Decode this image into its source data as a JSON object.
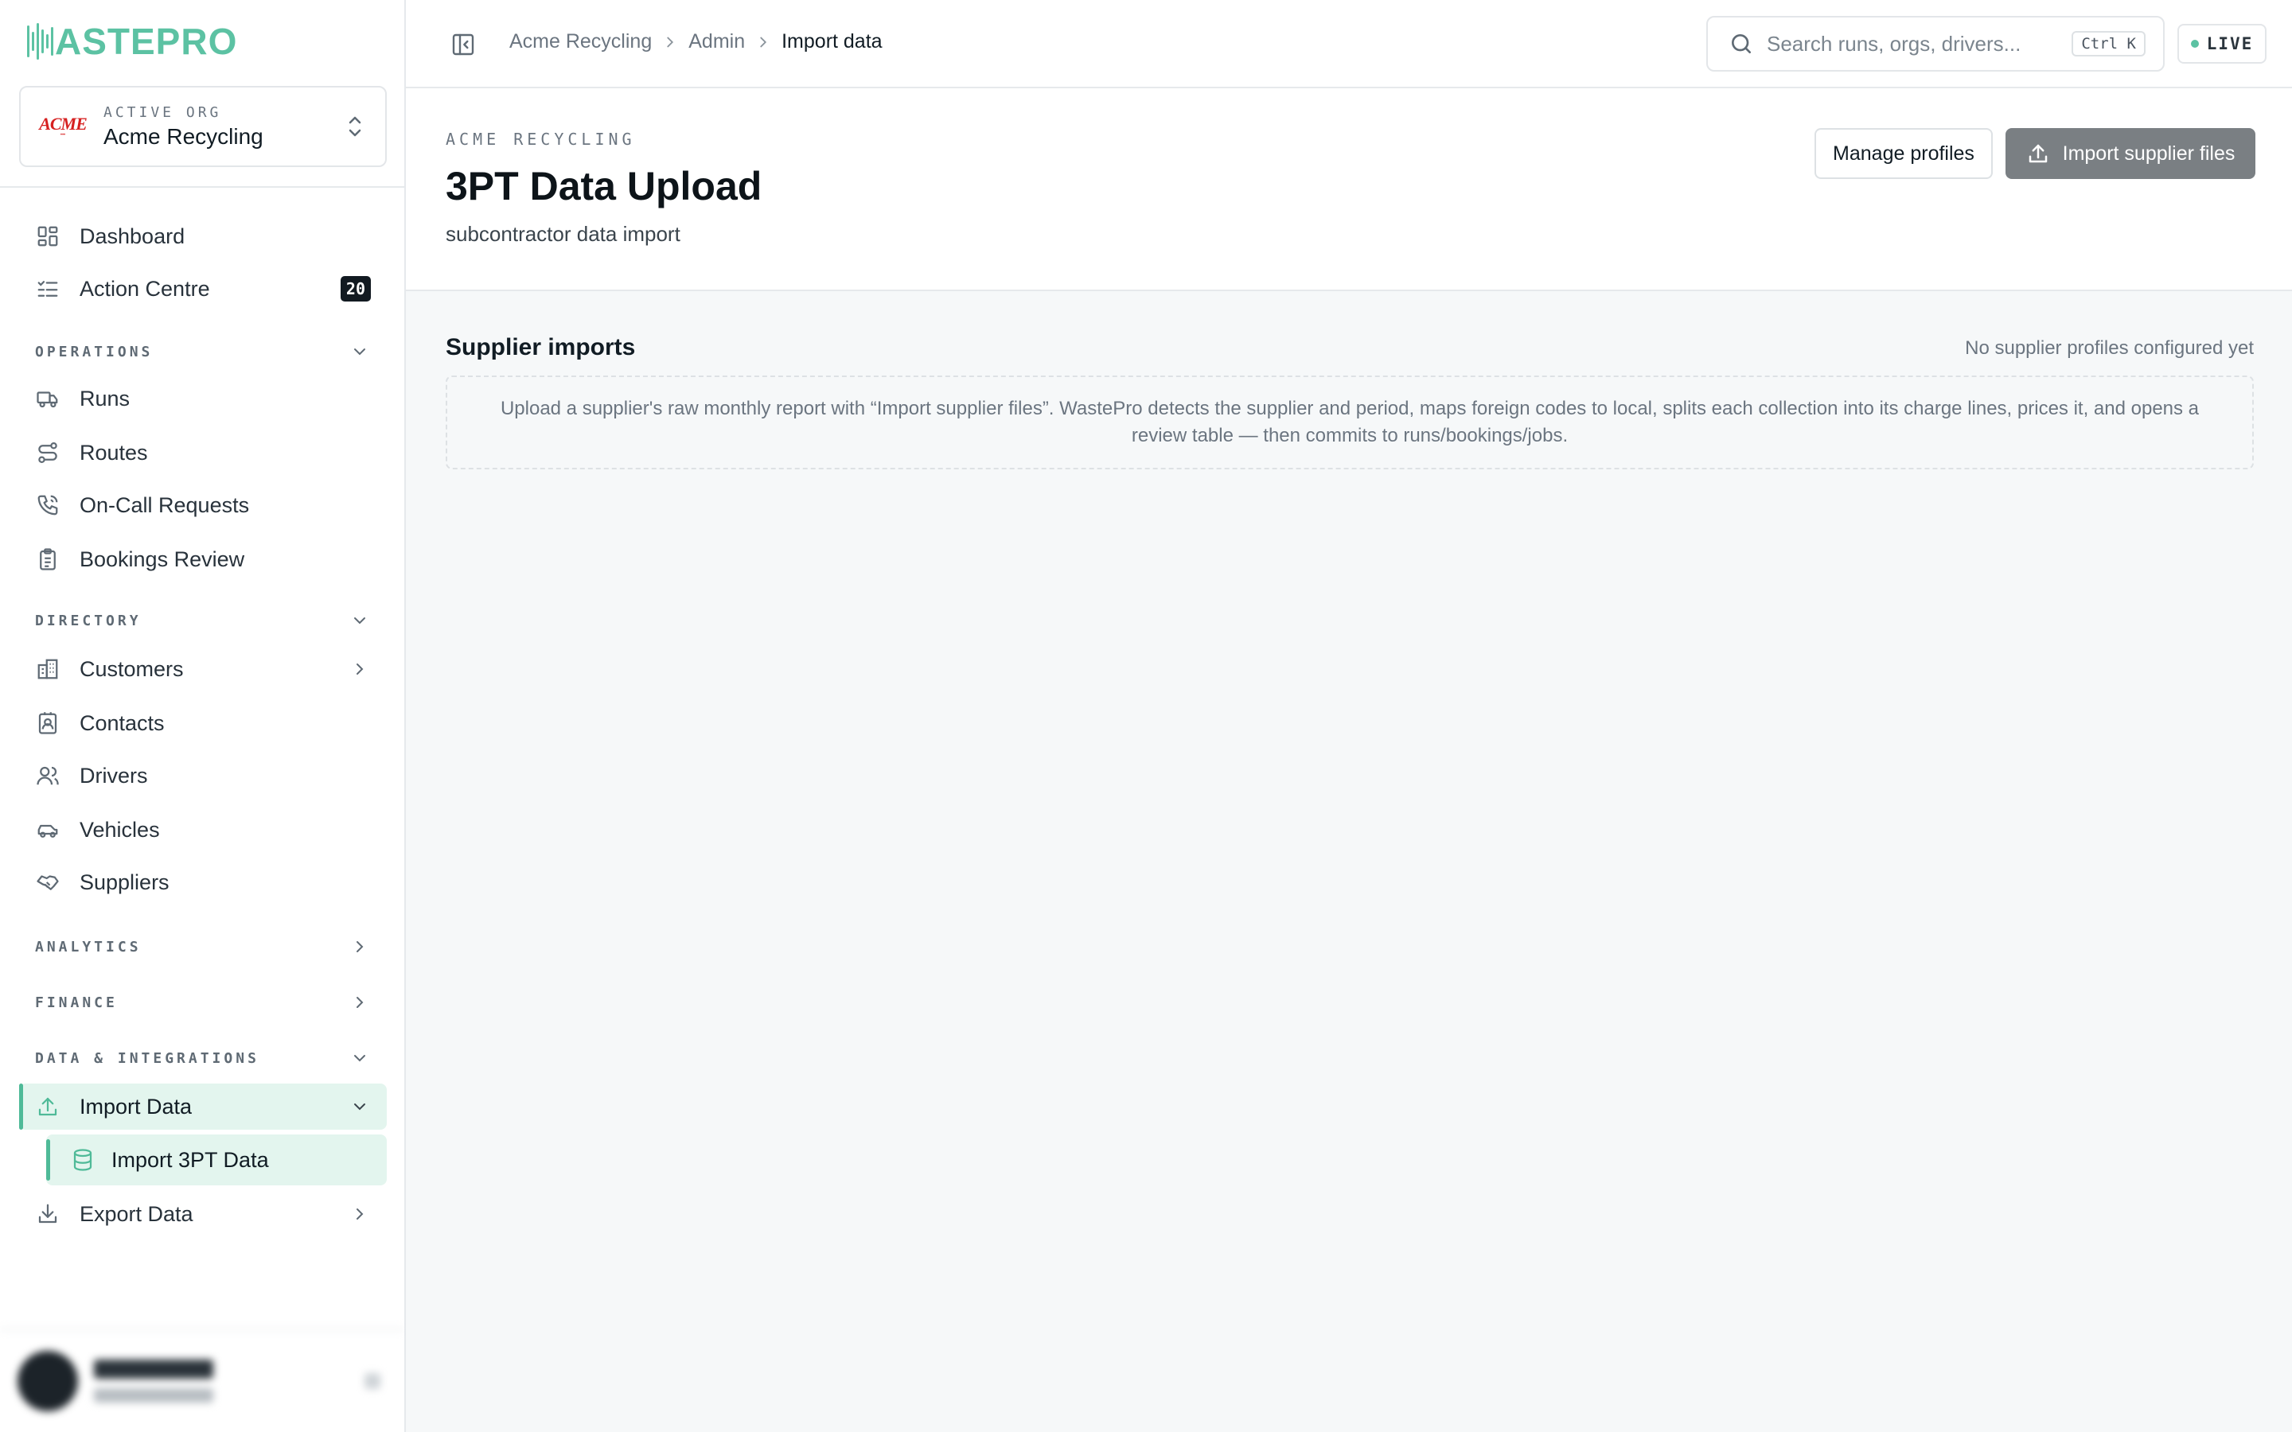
{
  "brand": {
    "logo_text": "ASTEPRO",
    "accent": "#5cc2a3"
  },
  "org": {
    "label": "ACTIVE ORG",
    "name": "Acme Recycling",
    "logo_text": "ACME"
  },
  "sidebar": {
    "top_items": [
      {
        "label": "Dashboard",
        "icon": "dashboard-icon"
      },
      {
        "label": "Action Centre",
        "icon": "checklist-icon",
        "badge": "20"
      }
    ],
    "operations": {
      "title": "OPERATIONS",
      "items": [
        {
          "label": "Runs",
          "icon": "truck-icon"
        },
        {
          "label": "Routes",
          "icon": "route-icon"
        },
        {
          "label": "On-Call Requests",
          "icon": "phone-icon"
        },
        {
          "label": "Bookings Review",
          "icon": "clipboard-icon"
        }
      ]
    },
    "directory": {
      "title": "DIRECTORY",
      "items": [
        {
          "label": "Customers",
          "icon": "building-icon"
        },
        {
          "label": "Contacts",
          "icon": "contact-card-icon"
        },
        {
          "label": "Drivers",
          "icon": "users-icon"
        },
        {
          "label": "Vehicles",
          "icon": "car-icon"
        },
        {
          "label": "Suppliers",
          "icon": "handshake-icon"
        }
      ]
    },
    "analytics": {
      "title": "ANALYTICS"
    },
    "finance": {
      "title": "FINANCE"
    },
    "data_integrations": {
      "title": "DATA & INTEGRATIONS",
      "import_data": "Import Data",
      "import_3pt": "Import 3PT Data",
      "export_data": "Export Data"
    }
  },
  "topbar": {
    "breadcrumbs": [
      "Acme Recycling",
      "Admin",
      "Import data"
    ],
    "search_placeholder": "Search runs, orgs, drivers...",
    "shortcut": "Ctrl K",
    "live_label": "LIVE"
  },
  "page": {
    "org_label": "ACME RECYCLING",
    "title": "3PT Data Upload",
    "subtitle": "subcontractor data import",
    "manage_profiles": "Manage profiles",
    "import_supplier_files": "Import supplier files"
  },
  "supplier_imports": {
    "title": "Supplier imports",
    "status": "No supplier profiles configured yet",
    "instructions": "Upload a supplier's raw monthly report with “Import supplier files”. WastePro detects the supplier and period, maps foreign codes to local, splits each collection into its charge lines, prices it, and opens a review table — then commits to runs/bookings/jobs."
  }
}
